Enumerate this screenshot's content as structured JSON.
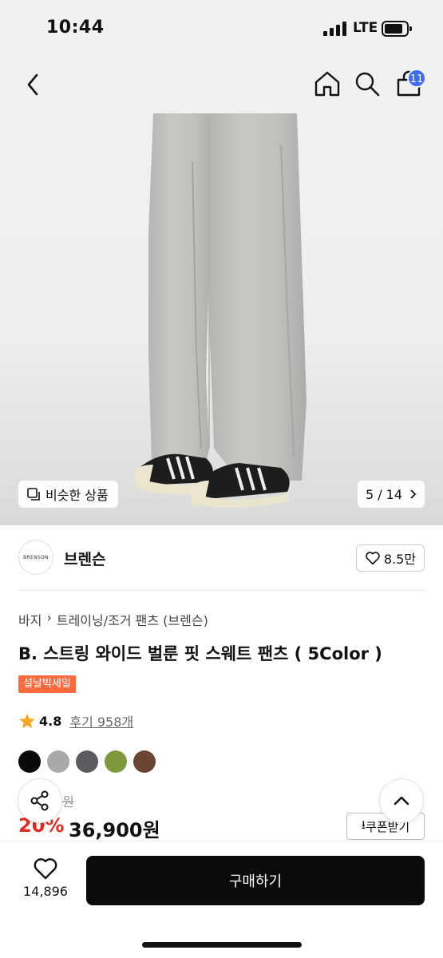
{
  "status_bar": {
    "time": "10:44",
    "network": "LTE"
  },
  "nav": {
    "cart_count": "11"
  },
  "gallery": {
    "similar_label": "비슷한 상품",
    "counter": "5 / 14"
  },
  "brand": {
    "logo_text": "BRENSON",
    "name": "브렌슨",
    "likes": "8.5만"
  },
  "product": {
    "breadcrumb": [
      "바지",
      "트레이닝/조거 팬츠 (브렌슨)"
    ],
    "title": "B. 스트링 와이드 벌룬 핏 스웨트 팬츠 ( 5Color )",
    "sale_badge": "설날빅세일",
    "rating": "4.8",
    "reviews": "후기 958개",
    "swatch_colors": [
      "#0a0a0a",
      "#a9a9a9",
      "#5a5c5f",
      "#7f9a3c",
      "#6a4531"
    ],
    "original_price": "9원",
    "discount": "20%",
    "price": "36,900원",
    "coupon_label": "쿠폰받기"
  },
  "bottom_bar": {
    "wish_count": "14,896",
    "buy_label": "구매하기"
  },
  "colors": {
    "accent_blue": "#3b6bf5",
    "sale_orange": "#ff6a3d",
    "discount_red": "#e8281f"
  }
}
